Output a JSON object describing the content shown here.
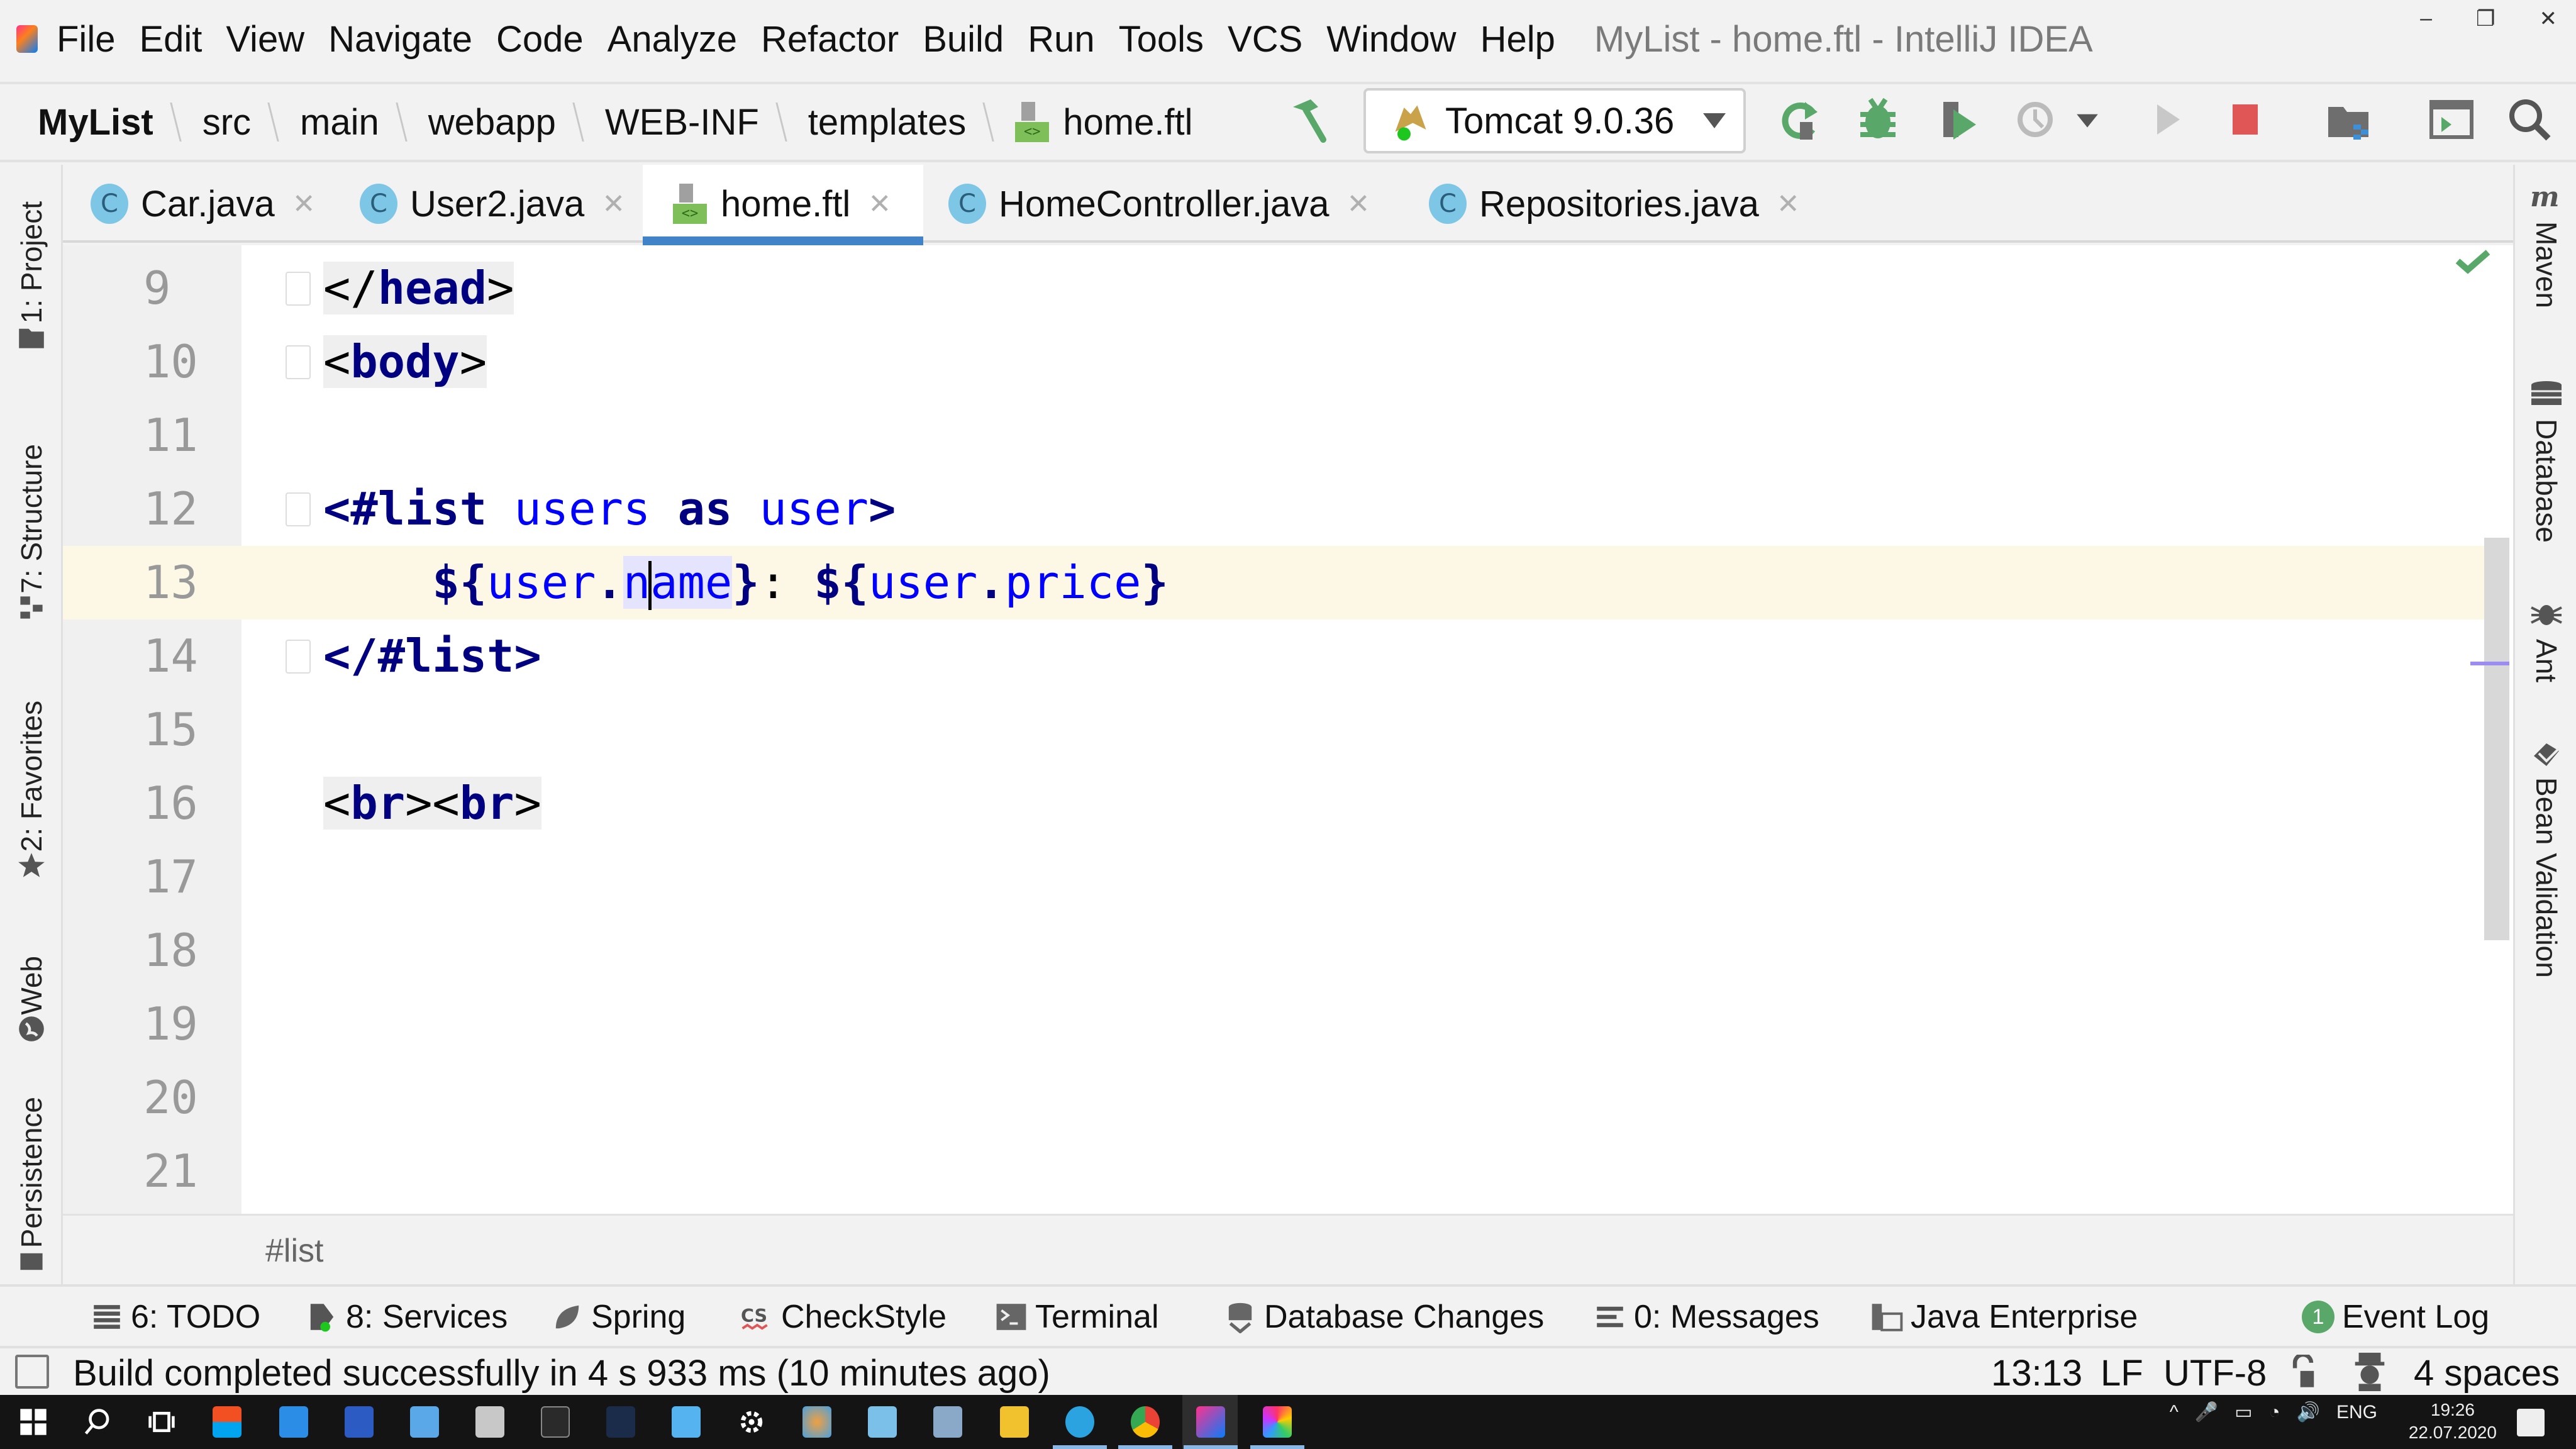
{
  "window": {
    "title": "MyList - home.ftl - IntelliJ IDEA",
    "controls": {
      "minimize": "–",
      "restore": "❐",
      "close": "✕"
    }
  },
  "menu": [
    "File",
    "Edit",
    "View",
    "Navigate",
    "Code",
    "Analyze",
    "Refactor",
    "Build",
    "Run",
    "Tools",
    "VCS",
    "Window",
    "Help"
  ],
  "navbar": {
    "crumbs": [
      "MyList",
      "src",
      "main",
      "webapp",
      "WEB-INF",
      "templates",
      "home.ftl"
    ],
    "run_config": "Tomcat 9.0.36",
    "icons": [
      "hammer-icon",
      "tomcat-icon",
      "rerun-icon",
      "debug-icon",
      "coverage-icon",
      "profile-icon",
      "run-icon",
      "stop-icon",
      "project-structure-icon",
      "terminal-window-icon",
      "search-icon"
    ]
  },
  "tabs": [
    {
      "label": "Car.java",
      "icon": "class-icon",
      "active": false
    },
    {
      "label": "User2.java",
      "icon": "class-icon",
      "active": false
    },
    {
      "label": "home.ftl",
      "icon": "ftl-file-icon",
      "active": true
    },
    {
      "label": "HomeController.java",
      "icon": "class-icon",
      "active": false
    },
    {
      "label": "Repositories.java",
      "icon": "class-icon",
      "active": false
    }
  ],
  "tab_close_glyph": "✕",
  "class_icon_letter": "C",
  "left_tools": [
    {
      "label": "1: Project",
      "icon": "folder-icon"
    },
    {
      "label": "7: Structure",
      "icon": "structure-icon"
    },
    {
      "label": "2: Favorites",
      "icon": "star-icon"
    },
    {
      "label": "Web",
      "icon": "globe-icon"
    },
    {
      "label": "Persistence",
      "icon": "persistence-icon"
    }
  ],
  "right_tools": [
    {
      "label": "Maven",
      "icon": "maven-icon"
    },
    {
      "label": "Database",
      "icon": "database-icon"
    },
    {
      "label": "Ant",
      "icon": "ant-icon"
    },
    {
      "label": "Bean Validation",
      "icon": "bean-validation-icon"
    }
  ],
  "editor": {
    "lines": [
      {
        "num": "9",
        "text": "</head>"
      },
      {
        "num": "10",
        "text": "<body>"
      },
      {
        "num": "11",
        "text": ""
      },
      {
        "num": "12",
        "text": "<#list users as user>"
      },
      {
        "num": "13",
        "text": "    ${user.name}: ${user.price}"
      },
      {
        "num": "14",
        "text": "</#list>"
      },
      {
        "num": "15",
        "text": ""
      },
      {
        "num": "16",
        "text": "<br><br>"
      },
      {
        "num": "17",
        "text": ""
      },
      {
        "num": "18",
        "text": ""
      },
      {
        "num": "19",
        "text": ""
      },
      {
        "num": "20",
        "text": ""
      },
      {
        "num": "21",
        "text": ""
      }
    ],
    "current_line": "13",
    "breadcrumb": "#list"
  },
  "bottom_tools": [
    {
      "label": "6: TODO",
      "icon": "todo-icon"
    },
    {
      "label": "8: Services",
      "icon": "services-icon"
    },
    {
      "label": "Spring",
      "icon": "spring-icon"
    },
    {
      "label": "CheckStyle",
      "icon": "checkstyle-icon"
    },
    {
      "label": "Terminal",
      "icon": "terminal-icon"
    },
    {
      "label": "Database Changes",
      "icon": "database-changes-icon"
    },
    {
      "label": "0: Messages",
      "icon": "messages-icon"
    },
    {
      "label": "Java Enterprise",
      "icon": "java-enterprise-icon"
    },
    {
      "label": "Event Log",
      "icon": "event-log-icon",
      "badge": "1"
    }
  ],
  "status": {
    "message": "Build completed successfully in 4 s 933 ms (10 minutes ago)",
    "position": "13:13",
    "line_separator": "LF",
    "encoding": "UTF-8",
    "indent": "4 spaces"
  },
  "taskbar": {
    "tray_lang": "ENG",
    "time": "19:26",
    "date": "22.07.2020"
  },
  "colors": {
    "accent": "#4083c9",
    "current_line": "#fcf8e5",
    "ftl_tag": "#000080",
    "ftl_var": "#0000ff",
    "stop": "#e05555",
    "run_green": "#59a869"
  }
}
